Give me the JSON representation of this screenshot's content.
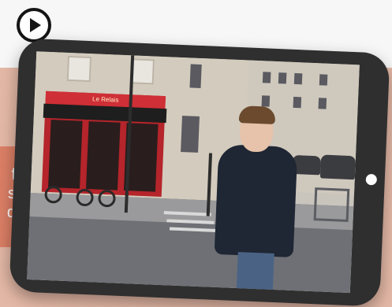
{
  "header": {
    "play_icon": "play-circle-icon"
  },
  "side_text": {
    "lines": [
      "f",
      "s",
      "d"
    ]
  },
  "colors": {
    "topbar": "#f7f7f7",
    "background": "#e4b8a6",
    "accent": "#dc7f66",
    "tablet_frame": "#2f2f2f"
  },
  "tablet": {
    "screen_image": "street-scene-photo",
    "shop_sign": "Le Relais",
    "home_button_icon": "home-button-dot"
  }
}
